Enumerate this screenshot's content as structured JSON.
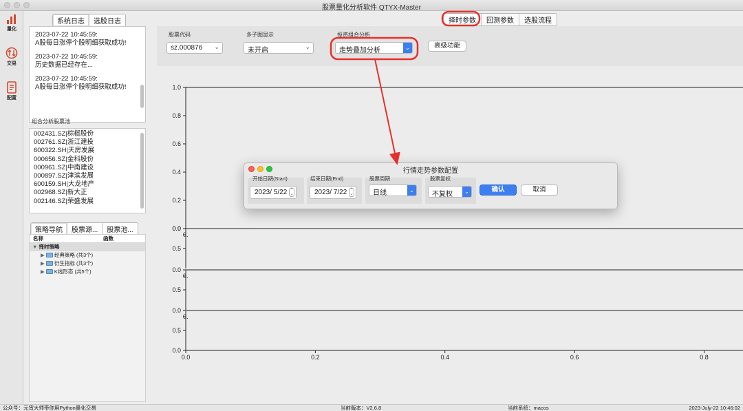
{
  "window": {
    "title": "股票量化分析软件 QTYX-Master"
  },
  "rail": {
    "items": [
      {
        "label": "量化",
        "icon": "bar-chart-icon"
      },
      {
        "label": "交易",
        "icon": "trade-arrows-icon"
      },
      {
        "label": "配置",
        "icon": "config-doc-icon"
      }
    ]
  },
  "log_tabs": [
    "系统日志",
    "选股日志"
  ],
  "logs": [
    {
      "time": "2023-07-22 10:45:59:",
      "message": "A股每日涨停个股明细获取成功!"
    },
    {
      "time": "2023-07-22 10:45:59:",
      "message": "历史数据已经存在..."
    },
    {
      "time": "2023-07-22 10:45:59:",
      "message": "A股每日涨停个股明细获取成功!"
    }
  ],
  "pool": {
    "label": "组合分析股票池",
    "items": [
      "002431.SZ|棕榈股份",
      "002761.SZ|浙江建投",
      "600322.SH|天房发展",
      "000656.SZ|金科股份",
      "000961.SZ|中南建设",
      "000897.SZ|津滨发展",
      "600159.SH|大龙地产",
      "002968.SZ|新大正",
      "002146.SZ|荣盛发展"
    ]
  },
  "nav_tabs": [
    "策略导航",
    "股票源...",
    "股票池..."
  ],
  "tree": {
    "columns": [
      "名称",
      "函数"
    ],
    "root": "择时策略",
    "children": [
      "经典策略 (共3个)",
      "衍生指标 (共3个)",
      "K线形态 (共5个)"
    ]
  },
  "main_tabs": [
    "择时参数",
    "回测参数",
    "选股流程"
  ],
  "params": {
    "stock_code": {
      "label": "股票代码",
      "value": "sz.000876"
    },
    "multi_chart": {
      "label": "多子图显示",
      "value": "未开启"
    },
    "portfolio": {
      "label": "投资组合分析",
      "value": "走势叠加分析"
    },
    "advanced_button": "高级功能"
  },
  "chart_data": {
    "type": "line",
    "main_yticks": [
      "1.0",
      "0.8",
      "0.6",
      "0.4",
      "0.2",
      "0.0"
    ],
    "sub_yticks": [
      "0.0",
      "0.",
      "0.5"
    ],
    "xticks": [
      "0.0",
      "0.2",
      "0.4",
      "0.6",
      "0.8"
    ],
    "xlim": [
      0,
      0.86
    ],
    "ylim": [
      0,
      1
    ],
    "series": []
  },
  "dialog": {
    "title": "行情走势参数配置",
    "start_label": "开始日期(Start)",
    "start_value": "2023/ 5/22",
    "end_label": "结束日期(End)",
    "end_value": "2023/ 7/22",
    "period_label": "股票周期",
    "period_value": "日线",
    "adjust_label": "股票复权",
    "adjust_value": "不复权",
    "confirm": "确认",
    "cancel": "取消"
  },
  "status": {
    "left": "公众号：元宵大师带你用Python量化交易",
    "version": "当前版本：V2.6.8",
    "system": "当前系统：macos",
    "time": "2023-July-22 10:46:02"
  },
  "colors": {
    "accent": "#3d7ef0",
    "highlight": "#e8302a",
    "rail_icon": "#d24a2e"
  }
}
